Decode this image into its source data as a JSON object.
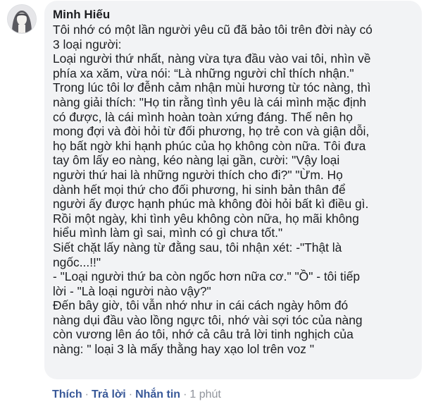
{
  "comment": {
    "author": "Minh Hiếu",
    "lines": [
      "Tôi nhớ có một lần người yêu cũ đã bảo tôi trên đời này có",
      "3 loại người:",
      "Loại người thứ nhất, nàng vừa tựa đầu vào vai tôi, nhìn về",
      "phía xa xăm, vừa nói: “Là những người chỉ thích nhận.\"",
      "Trong lúc tôi lơ đễnh cảm nhận mùi hương từ tóc nàng, thì",
      "nàng giải thích: \"Họ tin rằng tình yêu là cái mình mặc định",
      "có được, là cái mình hoàn toàn xứng đáng. Thế nên họ",
      "mong đợi và đòi hỏi từ đối phương, họ trẻ con và giận dỗi,",
      "họ bất ngờ khi hạnh phúc của họ không còn nữa. Tôi đưa",
      "tay ôm lấy eo nàng, kéo nàng lại gần, cười: \"Vậy loại",
      "người thứ hai là những người thích cho đi?\" \"Ừm. Họ",
      "dành hết mọi thứ cho đối phương, hi sinh bản thân để",
      "người ấy được hạnh phúc mà không đòi hỏi bất kì điều gì.",
      "Rồi một ngày, khi tình yêu không còn nữa, họ mãi không",
      "hiểu mình làm gì sai, mình có gì chưa tốt.\"",
      "Siết chặt lấy nàng từ đằng sau, tôi nhận xét: -\"Thật là",
      "ngốc...!!\"",
      "- \"Loại người thứ ba còn ngốc hơn nữa cơ.\" \"Ồ\" - tôi tiếp",
      "lời - \"Là loại người nào vậy?\"",
      "Đến bây giờ, tôi vẫn nhớ như in cái cách ngày hôm đó",
      "nàng dụi đầu vào lồng ngực tôi, nhớ vài sợi tóc của nàng",
      "còn vương lên áo tôi, nhớ cả câu trả lời tinh nghịch của",
      "nàng: \" loại 3 là mấy thằng hay xạo lol trên voz \""
    ]
  },
  "actions": {
    "like": "Thích",
    "reply": "Trả lời",
    "message": "Nhắn tin",
    "separator": "·",
    "time": "1 phút"
  }
}
